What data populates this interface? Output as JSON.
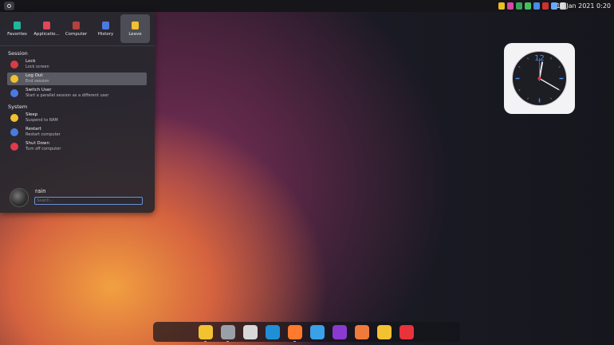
{
  "topbar": {
    "datetime": "18 Jan 2021 0:20"
  },
  "tray_icons": [
    {
      "name": "notes-icon",
      "color": "#e8c020"
    },
    {
      "name": "screenshot-icon",
      "color": "#d84aa0"
    },
    {
      "name": "chat-icon",
      "color": "#3aa35a"
    },
    {
      "name": "battery-icon",
      "color": "#44c060"
    },
    {
      "name": "bluetooth-icon",
      "color": "#4a8ae8"
    },
    {
      "name": "input-method-icon",
      "color": "#d03030"
    },
    {
      "name": "wifi-icon",
      "color": "#6aa8ff"
    },
    {
      "name": "chevron-down-icon",
      "color": "#cfcfcf"
    }
  ],
  "menu": {
    "tabs": [
      {
        "label": "Favorites",
        "icon": "bookmark-icon",
        "color": "#22b59a"
      },
      {
        "label": "Applicatio...",
        "icon": "apps-icon",
        "color": "#e0475a"
      },
      {
        "label": "Computer",
        "icon": "computer-icon",
        "color": "#b54040"
      },
      {
        "label": "History",
        "icon": "history-icon",
        "color": "#4a7ae0"
      },
      {
        "label": "Leave",
        "icon": "hourglass-icon",
        "color": "#f0c030"
      }
    ],
    "session_header": "Session",
    "system_header": "System",
    "session_items": [
      {
        "title": "Lock",
        "sub": "Lock screen",
        "icon": "lock-icon",
        "color": "#d93c46"
      },
      {
        "title": "Log Out",
        "sub": "End session",
        "icon": "hourglass-icon",
        "color": "#f0c030"
      },
      {
        "title": "Switch User",
        "sub": "Start a parallel session as a different user",
        "icon": "user-icon",
        "color": "#4a7ae0"
      }
    ],
    "system_items": [
      {
        "title": "Sleep",
        "sub": "Suspend to RAM",
        "icon": "moon-icon",
        "color": "#f0c030"
      },
      {
        "title": "Restart",
        "sub": "Restart computer",
        "icon": "restart-icon",
        "color": "#4a7ae0"
      },
      {
        "title": "Shut Down",
        "sub": "Turn off computer",
        "icon": "power-icon",
        "color": "#e03a4c"
      }
    ],
    "user": {
      "name": "rain"
    },
    "search": {
      "placeholder": "Search..."
    }
  },
  "clock_widget": {
    "number_12": "12",
    "hour_hand_deg": 10,
    "minute_hand_deg": 120
  },
  "dock": [
    {
      "name": "files-app",
      "color": "#f2c230"
    },
    {
      "name": "settings-app",
      "color": "#9aa0a8"
    },
    {
      "name": "inkscape-app",
      "color": "#d8d8d8"
    },
    {
      "name": "browser-app",
      "color": "#1f8fd6"
    },
    {
      "name": "firefox-app",
      "color": "#ff7a2c"
    },
    {
      "name": "github-app",
      "color": "#3aa0e8"
    },
    {
      "name": "kv-app",
      "color": "#8a3ad0"
    },
    {
      "name": "store-app",
      "color": "#f07a3a"
    },
    {
      "name": "wechat-app",
      "color": "#f2c230"
    },
    {
      "name": "music-app",
      "color": "#e8323c"
    }
  ]
}
